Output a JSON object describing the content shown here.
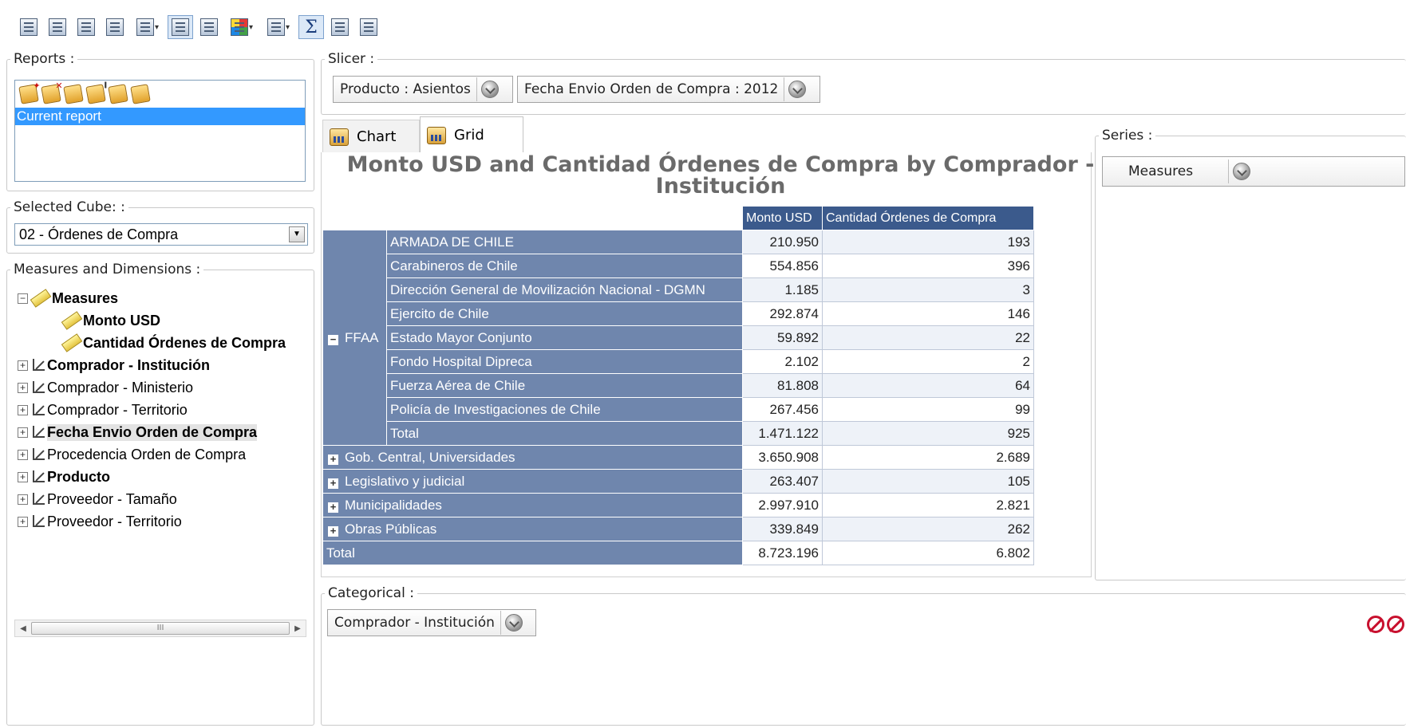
{
  "toolbar": {
    "buttons": [
      "show-mdx-icon",
      "pivot-icon",
      "copy-icon",
      "paste-icon",
      "filter-icon",
      "outline-icon",
      "chart-grid-icon",
      "color-icon",
      "row-height-icon",
      "sum-icon",
      "swap-axes-icon",
      "export-chart-icon"
    ]
  },
  "reports": {
    "legend": "Reports :",
    "items": [
      "Current report"
    ]
  },
  "cube": {
    "legend": "Selected Cube: :",
    "value": "02 - Órdenes de Compra"
  },
  "tree": {
    "legend": "Measures and Dimensions :",
    "measures_label": "Measures",
    "measures": [
      "Monto USD",
      "Cantidad Órdenes de Compra"
    ],
    "dimensions": [
      {
        "label": "Comprador - Institución",
        "bold": true
      },
      {
        "label": "Comprador - Ministerio",
        "bold": false
      },
      {
        "label": "Comprador - Territorio",
        "bold": false
      },
      {
        "label": "Fecha Envio Orden de Compra",
        "bold": true
      },
      {
        "label": "Procedencia Orden de Compra",
        "bold": false
      },
      {
        "label": "Producto",
        "bold": true
      },
      {
        "label": "Proveedor - Tamaño",
        "bold": false
      },
      {
        "label": "Proveedor - Territorio",
        "bold": false
      }
    ]
  },
  "scrollbar": {
    "thumb": "III"
  },
  "slicer": {
    "legend": "Slicer :",
    "items": [
      "Producto : Asientos",
      "Fecha Envio Orden de Compra : 2012"
    ]
  },
  "tabs": {
    "chart": "Chart",
    "grid": "Grid"
  },
  "grid": {
    "title": "Monto USD and Cantidad Órdenes de Compra by Comprador - Institución",
    "columns": [
      "Monto USD",
      "Cantidad Órdenes de Compra"
    ],
    "group": "FFAA",
    "group_rows": [
      {
        "label": "ARMADA DE CHILE",
        "monto": "210.950",
        "cantidad": "193"
      },
      {
        "label": "Carabineros de Chile",
        "monto": "554.856",
        "cantidad": "396"
      },
      {
        "label": "Dirección General de Movilización Nacional - DGMN",
        "monto": "1.185",
        "cantidad": "3"
      },
      {
        "label": "Ejercito de Chile",
        "monto": "292.874",
        "cantidad": "146"
      },
      {
        "label": "Estado Mayor Conjunto",
        "monto": "59.892",
        "cantidad": "22"
      },
      {
        "label": "Fondo Hospital Dipreca",
        "monto": "2.102",
        "cantidad": "2"
      },
      {
        "label": "Fuerza Aérea de Chile",
        "monto": "81.808",
        "cantidad": "64"
      },
      {
        "label": "Policía de Investigaciones de Chile",
        "monto": "267.456",
        "cantidad": "99"
      },
      {
        "label": "Total",
        "monto": "1.471.122",
        "cantidad": "925"
      }
    ],
    "collapsed_rows": [
      {
        "label": "Gob. Central, Universidades",
        "monto": "3.650.908",
        "cantidad": "2.689"
      },
      {
        "label": "Legislativo y judicial",
        "monto": "263.407",
        "cantidad": "105"
      },
      {
        "label": "Municipalidades",
        "monto": "2.997.910",
        "cantidad": "2.821"
      },
      {
        "label": "Obras Públicas",
        "monto": "339.849",
        "cantidad": "262"
      }
    ],
    "total": {
      "label": "Total",
      "monto": "8.723.196",
      "cantidad": "6.802"
    }
  },
  "series": {
    "legend": "Series :",
    "items": [
      "Measures"
    ]
  },
  "categorical": {
    "legend": "Categorical :",
    "items": [
      "Comprador - Institución"
    ]
  },
  "colors": {
    "header": "#3b5a8c",
    "row": "#6f86ad",
    "cell": "#eef2f8",
    "selection": "#3399ff"
  }
}
